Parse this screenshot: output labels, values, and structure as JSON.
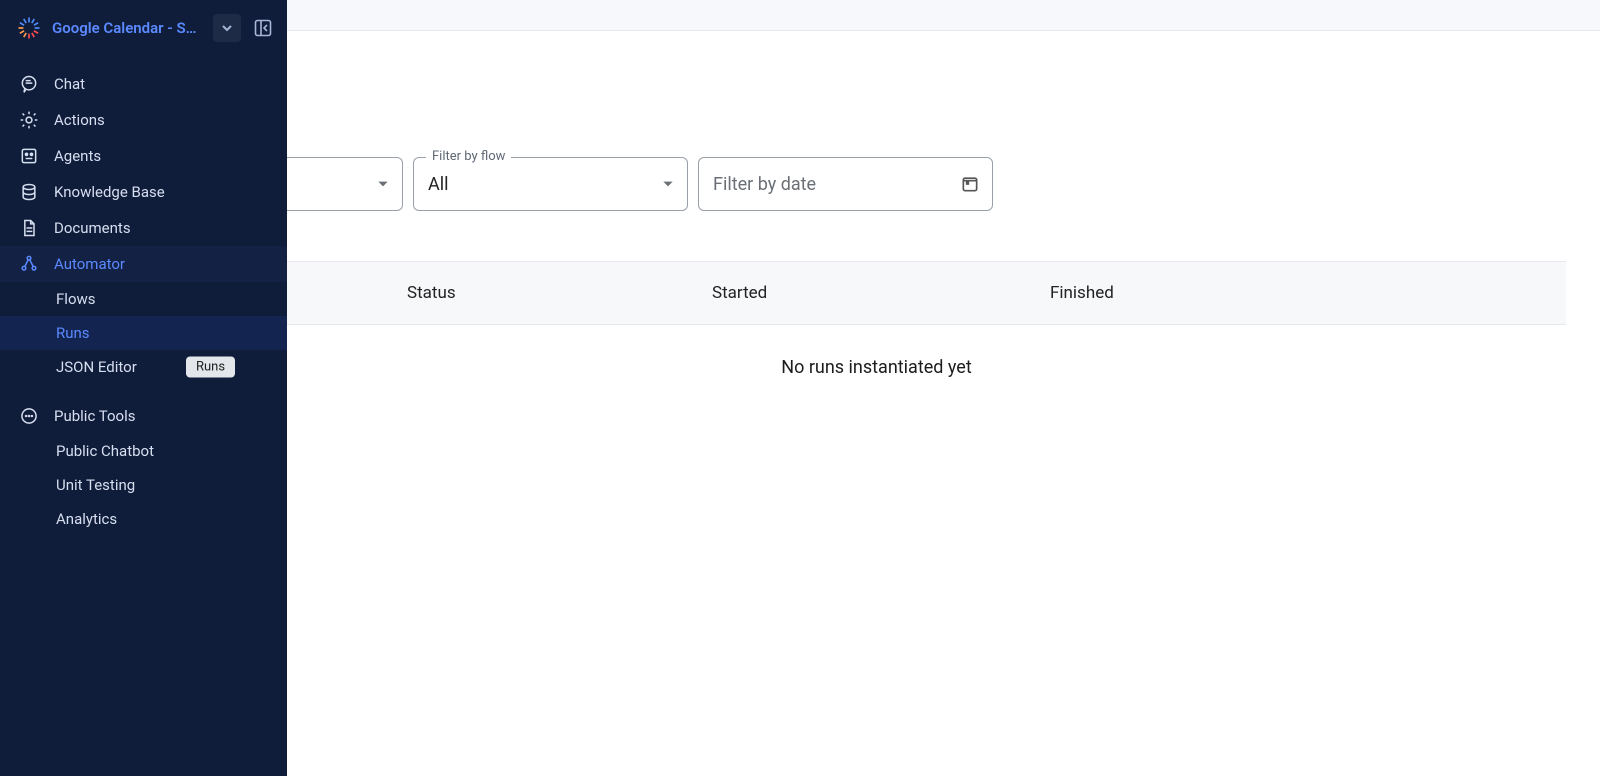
{
  "header": {
    "project_title": "Google Calendar - S…"
  },
  "sidebar": {
    "chat": "Chat",
    "actions": "Actions",
    "agents": "Agents",
    "knowledge": "Knowledge Base",
    "documents": "Documents",
    "automator": "Automator",
    "automator_children": {
      "flows": "Flows",
      "runs": "Runs",
      "json": "JSON Editor"
    },
    "public_tools": "Public Tools",
    "public_tools_children": {
      "chatbot": "Public Chatbot",
      "unit": "Unit Testing",
      "analytics": "Analytics"
    },
    "tooltip_runs": "Runs"
  },
  "filters": {
    "flow_label": "Filter by flow",
    "flow_value": "All",
    "date_placeholder": "Filter by date"
  },
  "table": {
    "columns": {
      "status": "Status",
      "started": "Started",
      "finished": "Finished"
    },
    "empty_msg": "No runs instantiated yet"
  }
}
